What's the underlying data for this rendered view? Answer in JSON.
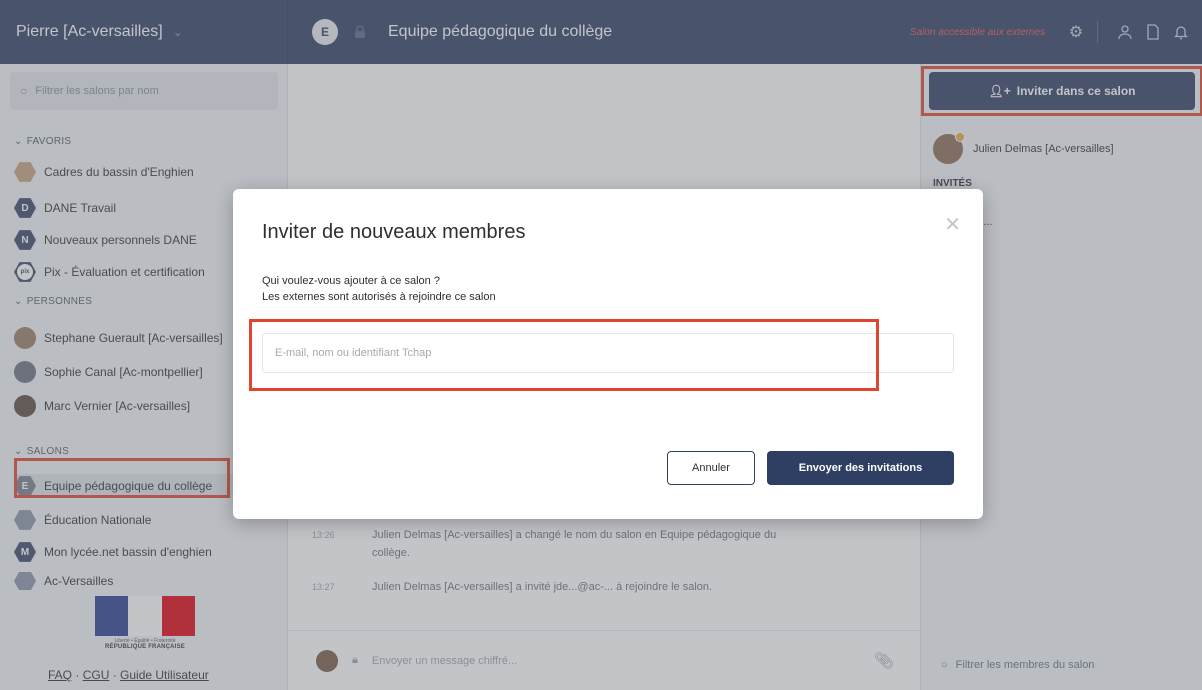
{
  "header": {
    "user_name": "Pierre [Ac-versailles]",
    "room_avatar_letter": "E",
    "room_title": "Equipe pédagogique du collège",
    "external_note": "Salon accessible aux externes"
  },
  "sidebar": {
    "filter_placeholder": "Filtrer les salons par nom",
    "sections": {
      "favorites": "FAVORIS",
      "people": "PERSONNES",
      "rooms": "SALONS"
    },
    "favorites": [
      {
        "label": "Cadres du bassin d'Enghien",
        "letter": "",
        "color": "#c9a07a"
      },
      {
        "label": "DANE Travail",
        "letter": "D",
        "color": "#3a4566"
      },
      {
        "label": "Nouveaux personnels DANE",
        "letter": "N",
        "color": "#3a4566"
      },
      {
        "label": "Pix - Évaluation et certification",
        "letter": "pix",
        "color": "#ffffff"
      }
    ],
    "people": [
      {
        "label": "Stephane Guerault [Ac-versailles]",
        "color": "#9b7a62"
      },
      {
        "label": "Sophie Canal [Ac-montpellier]",
        "color": "#6b7080"
      },
      {
        "label": "Marc Vernier [Ac-versailles]",
        "color": "#5a4a3f"
      }
    ],
    "rooms": [
      {
        "label": "Equipe pédagogique du collège",
        "letter": "E",
        "color": "#7a7f8a"
      },
      {
        "label": "Éducation Nationale",
        "letter": "",
        "color": "#8a93a8"
      },
      {
        "label": "Mon lycée.net bassin d'enghien",
        "letter": "M",
        "color": "#3a4566"
      },
      {
        "label": "Ac-Versailles",
        "letter": "",
        "color": "#8a93a8"
      }
    ],
    "logo": {
      "motto": "Liberté • Égalité • Fraternité",
      "republic": "RÉPUBLIQUE FRANÇAISE"
    },
    "footer": {
      "faq": "FAQ",
      "sep": " · ",
      "cgu": "CGU",
      "guide": "Guide Utilisateur"
    }
  },
  "main": {
    "messages": [
      {
        "time": "13:26",
        "text": "Julien Delmas [Ac-versailles] a changé le nom du salon en Equipe pédagogique du collège."
      },
      {
        "time": "13:27",
        "text": "Julien Delmas [Ac-versailles] a invité jde...@ac-... à rejoindre le salon."
      }
    ],
    "composer_placeholder": "Envoyer un message chiffré..."
  },
  "right_panel": {
    "invite_button": "Inviter dans ce salon",
    "member_name": "Julien Delmas [Ac-versailles]",
    "invited_title": "INVITÉS",
    "invited_item": "jde...@ac-...",
    "filter_placeholder": "Filtrer les membres du salon"
  },
  "modal": {
    "title": "Inviter de nouveaux membres",
    "question": "Qui voulez-vous ajouter à ce salon ?",
    "externals_note": "Les externes sont autorisés à rejoindre ce salon",
    "input_placeholder": "E-mail, nom ou identifiant Tchap",
    "input_value": "",
    "cancel_button": "Annuler",
    "send_button": "Envoyer des invitations"
  },
  "colors": {
    "brand_navy": "#2f3f63",
    "highlight_red": "#e0452e",
    "external_note": "#e5544b"
  }
}
